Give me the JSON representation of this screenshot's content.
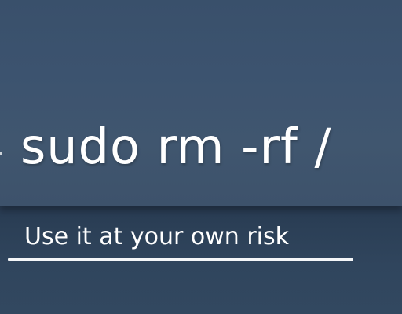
{
  "slide": {
    "command": "sudo rm -rf /",
    "caption": "Use it at your own risk"
  }
}
